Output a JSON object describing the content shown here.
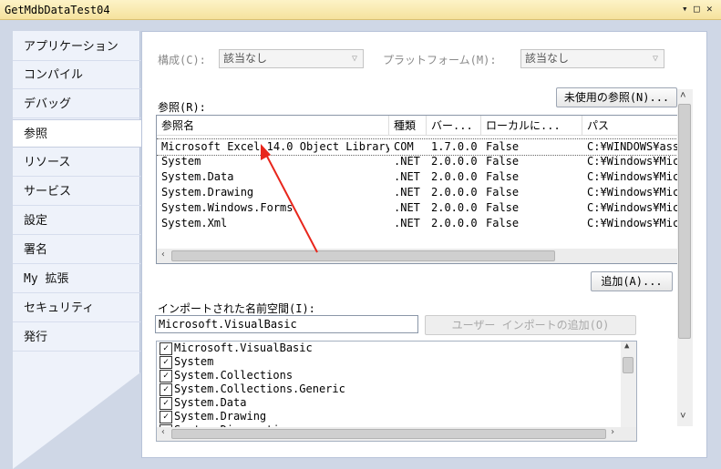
{
  "window": {
    "title": "GetMdbDataTest04",
    "controls": [
      "▾",
      "□",
      "✕"
    ]
  },
  "sidebar": {
    "items": [
      {
        "label": "アプリケーション"
      },
      {
        "label": "コンパイル"
      },
      {
        "label": "デバッグ"
      },
      {
        "label": "参照",
        "active": true
      },
      {
        "label": "リソース"
      },
      {
        "label": "サービス"
      },
      {
        "label": "設定"
      },
      {
        "label": "署名"
      },
      {
        "label": "My 拡張"
      },
      {
        "label": "セキュリティ"
      },
      {
        "label": "発行"
      }
    ]
  },
  "config": {
    "config_label": "構成(C):",
    "config_value": "該当なし",
    "platform_label": "プラットフォーム(M):",
    "platform_value": "該当なし"
  },
  "references": {
    "label": "参照(R):",
    "unused_button": "未使用の参照(N)...",
    "add_button": "追加(A)...",
    "columns": [
      "参照名",
      "種類",
      "バー...",
      "ローカルに...",
      "パス"
    ],
    "rows": [
      [
        "Microsoft Excel 14.0 Object Library",
        "COM",
        "1.7.0.0",
        "False",
        "C:¥WINDOWS¥asse"
      ],
      [
        "System",
        ".NET",
        "2.0.0.0",
        "False",
        "C:¥Windows¥Mic"
      ],
      [
        "System.Data",
        ".NET",
        "2.0.0.0",
        "False",
        "C:¥Windows¥Mic"
      ],
      [
        "System.Drawing",
        ".NET",
        "2.0.0.0",
        "False",
        "C:¥Windows¥Mic"
      ],
      [
        "System.Windows.Forms",
        ".NET",
        "2.0.0.0",
        "False",
        "C:¥Windows¥Mic"
      ],
      [
        "System.Xml",
        ".NET",
        "2.0.0.0",
        "False",
        "C:¥Windows¥Mic"
      ]
    ]
  },
  "imports": {
    "label": "インポートされた名前空間(I):",
    "input_value": "Microsoft.VisualBasic",
    "add_user_import_button": "ユーザー インポートの追加(O)",
    "items": [
      {
        "label": "Microsoft.VisualBasic",
        "checked": true
      },
      {
        "label": "System",
        "checked": true
      },
      {
        "label": "System.Collections",
        "checked": true
      },
      {
        "label": "System.Collections.Generic",
        "checked": true
      },
      {
        "label": "System.Data",
        "checked": true
      },
      {
        "label": "System.Drawing",
        "checked": true
      },
      {
        "label": "System.Diagnostics",
        "checked": true
      }
    ]
  },
  "colors": {
    "arrow": "#e8261c",
    "titlebar": "#f5e29d",
    "frame": "#cfd7e6"
  }
}
